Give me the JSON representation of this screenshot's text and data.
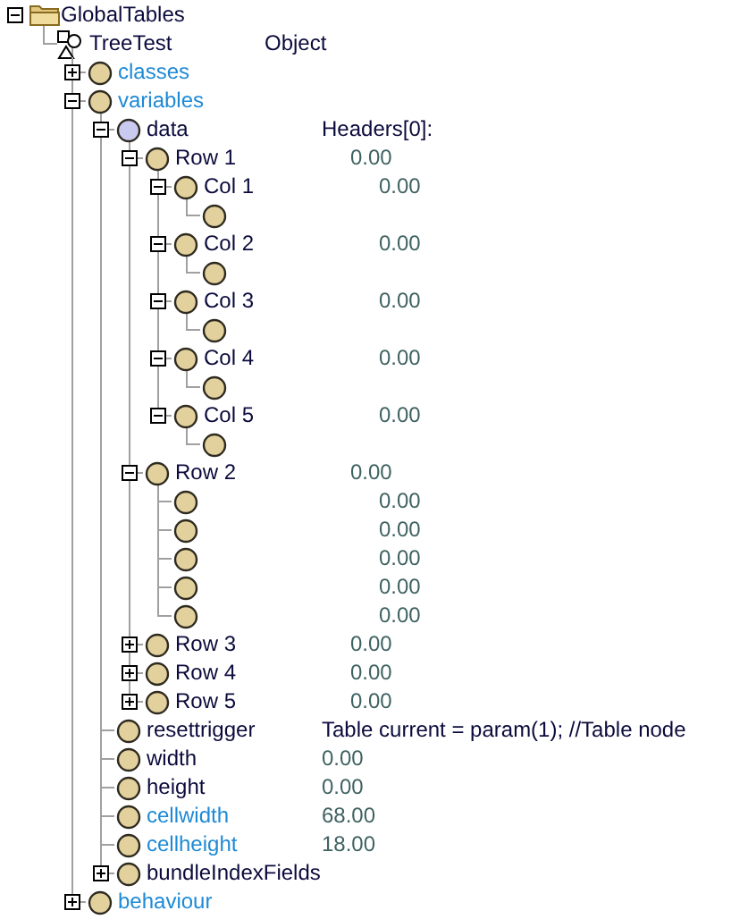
{
  "tree": [
    {
      "label": "GlobalTables",
      "kind": "folder",
      "color": "#0a0a3c",
      "expanded": true,
      "children": [
        {
          "label": "TreeTest",
          "kind": "object",
          "color": "#0a0a3c",
          "value": {
            "text": "Object",
            "kind": "text"
          },
          "children": [
            {
              "label": "classes",
              "kind": "member",
              "color": "#1e8ad6",
              "expanded": false
            },
            {
              "label": "variables",
              "kind": "member",
              "color": "#1e8ad6",
              "expanded": true,
              "children": [
                {
                  "label": "data",
                  "kind": "table",
                  "color": "#0a0a3c",
                  "value": {
                    "text": "Headers[0]:",
                    "kind": "text"
                  },
                  "expanded": true,
                  "children": [
                    {
                      "label": "Row 1",
                      "kind": "member",
                      "color": "#0a0a3c",
                      "value": {
                        "text": "0.00",
                        "kind": "number"
                      },
                      "expanded": true,
                      "children": [
                        {
                          "label": "Col 1",
                          "kind": "member",
                          "color": "#0a0a3c",
                          "value": {
                            "text": "0.00",
                            "kind": "number"
                          },
                          "expanded": true,
                          "children": [
                            {
                              "kind": "member"
                            }
                          ]
                        },
                        {
                          "label": "Col 2",
                          "kind": "member",
                          "color": "#0a0a3c",
                          "value": {
                            "text": "0.00",
                            "kind": "number"
                          },
                          "expanded": true,
                          "children": [
                            {
                              "kind": "member"
                            }
                          ]
                        },
                        {
                          "label": "Col 3",
                          "kind": "member",
                          "color": "#0a0a3c",
                          "value": {
                            "text": "0.00",
                            "kind": "number"
                          },
                          "expanded": true,
                          "children": [
                            {
                              "kind": "member"
                            }
                          ]
                        },
                        {
                          "label": "Col 4",
                          "kind": "member",
                          "color": "#0a0a3c",
                          "value": {
                            "text": "0.00",
                            "kind": "number"
                          },
                          "expanded": true,
                          "children": [
                            {
                              "kind": "member"
                            }
                          ]
                        },
                        {
                          "label": "Col 5",
                          "kind": "member",
                          "color": "#0a0a3c",
                          "value": {
                            "text": "0.00",
                            "kind": "number"
                          },
                          "expanded": true,
                          "children": [
                            {
                              "kind": "member"
                            }
                          ]
                        }
                      ]
                    },
                    {
                      "label": "Row 2",
                      "kind": "member",
                      "color": "#0a0a3c",
                      "value": {
                        "text": "0.00",
                        "kind": "number"
                      },
                      "expanded": true,
                      "children": [
                        {
                          "kind": "member",
                          "value": {
                            "text": "0.00",
                            "kind": "number"
                          }
                        },
                        {
                          "kind": "member",
                          "value": {
                            "text": "0.00",
                            "kind": "number"
                          }
                        },
                        {
                          "kind": "member",
                          "value": {
                            "text": "0.00",
                            "kind": "number"
                          }
                        },
                        {
                          "kind": "member",
                          "value": {
                            "text": "0.00",
                            "kind": "number"
                          }
                        },
                        {
                          "kind": "member",
                          "value": {
                            "text": "0.00",
                            "kind": "number"
                          }
                        }
                      ]
                    },
                    {
                      "label": "Row 3",
                      "kind": "member",
                      "color": "#0a0a3c",
                      "value": {
                        "text": "0.00",
                        "kind": "number"
                      },
                      "expanded": false
                    },
                    {
                      "label": "Row 4",
                      "kind": "member",
                      "color": "#0a0a3c",
                      "value": {
                        "text": "0.00",
                        "kind": "number"
                      },
                      "expanded": false
                    },
                    {
                      "label": "Row 5",
                      "kind": "member",
                      "color": "#0a0a3c",
                      "value": {
                        "text": "0.00",
                        "kind": "number"
                      },
                      "expanded": false
                    }
                  ]
                },
                {
                  "label": "resettrigger",
                  "kind": "member",
                  "color": "#0a0a3c",
                  "value": {
                    "text": "Table current = param(1); //Table node",
                    "kind": "text"
                  }
                },
                {
                  "label": "width",
                  "kind": "member",
                  "color": "#0a0a3c",
                  "value": {
                    "text": "0.00",
                    "kind": "number"
                  }
                },
                {
                  "label": "height",
                  "kind": "member",
                  "color": "#0a0a3c",
                  "value": {
                    "text": "0.00",
                    "kind": "number"
                  }
                },
                {
                  "label": "cellwidth",
                  "kind": "member",
                  "color": "#1e8ad6",
                  "value": {
                    "text": "68.00",
                    "kind": "number"
                  }
                },
                {
                  "label": "cellheight",
                  "kind": "member",
                  "color": "#1e8ad6",
                  "value": {
                    "text": "18.00",
                    "kind": "number"
                  }
                },
                {
                  "label": "bundleIndexFields",
                  "kind": "member",
                  "color": "#0a0a3c",
                  "expanded": false
                }
              ]
            },
            {
              "label": "behaviour",
              "kind": "member",
              "color": "#1e8ad6",
              "expanded": false
            }
          ]
        }
      ]
    }
  ]
}
